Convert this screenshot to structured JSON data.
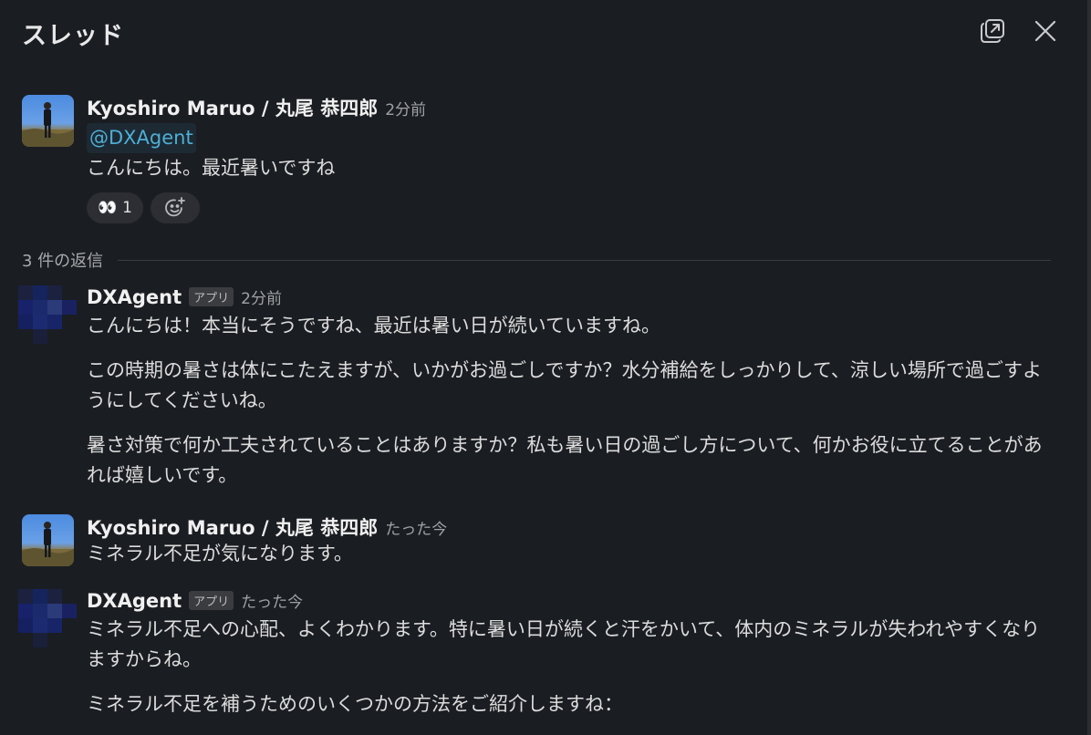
{
  "header": {
    "title": "スレッド"
  },
  "parent": {
    "author": "Kyoshiro Maruo / 丸尾 恭四郎",
    "time": "2分前",
    "mention": "@DXAgent",
    "text": "こんにちは。最近暑いですね",
    "reactions": [
      {
        "emoji": "👀",
        "count": "1"
      }
    ]
  },
  "replies_label": "3 件の返信",
  "replies": [
    {
      "author": "DXAgent",
      "badge": "アプリ",
      "time": "2分前",
      "paragraphs": [
        "こんにちは！本当にそうですね、最近は暑い日が続いていますね。",
        "この時期の暑さは体にこたえますが、いかがお過ごしですか？水分補給をしっかりして、涼しい場所で過ごすようにしてくださいね。",
        "暑さ対策で何か工夫されていることはありますか？私も暑い日の過ごし方について、何かお役に立てることがあれば嬉しいです。"
      ]
    },
    {
      "author": "Kyoshiro Maruo / 丸尾 恭四郎",
      "time": "たった今",
      "paragraphs": [
        "ミネラル不足が気になります。"
      ]
    },
    {
      "author": "DXAgent",
      "badge": "アプリ",
      "time": "たった今",
      "paragraphs": [
        "ミネラル不足への心配、よくわかります。特に暑い日が続くと汗をかいて、体内のミネラルが失われやすくなりますからね。",
        "ミネラル不足を補うためのいくつかの方法をご紹介しますね："
      ]
    }
  ],
  "colors": {
    "background": "#1a1d21",
    "mention": "#4faed6",
    "bot_avatar": "#1b2a6b"
  }
}
